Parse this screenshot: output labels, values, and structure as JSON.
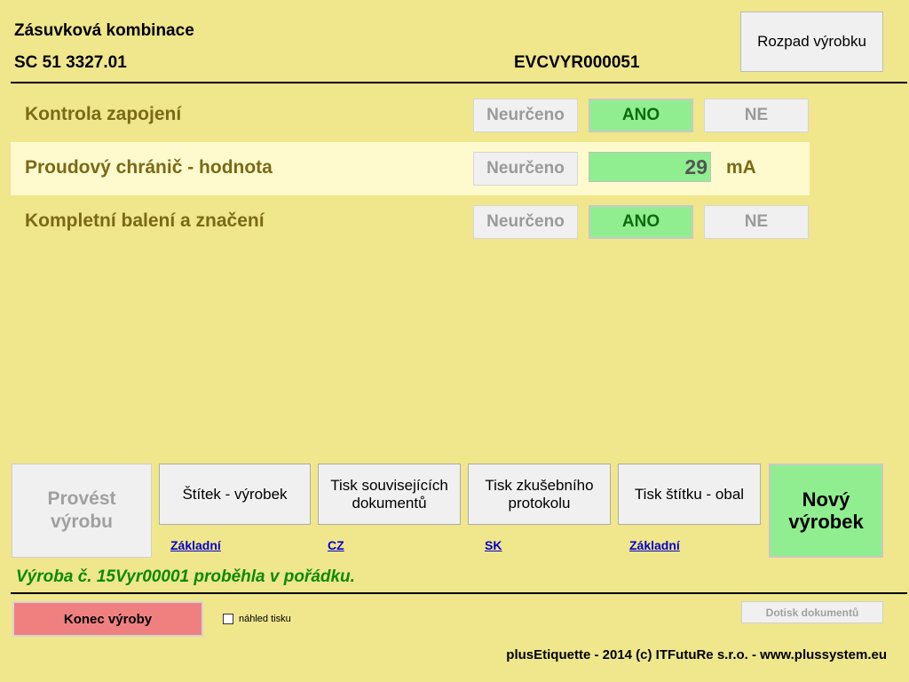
{
  "header": {
    "product_name": "Zásuvková kombinace",
    "product_code": "SC 51 3327.01",
    "record_id": "EVCVYR000051",
    "breakdown_button": "Rozpad výrobku"
  },
  "checks": [
    {
      "label": "Kontrola zapojení",
      "undetermined": "Neurčeno",
      "yes": "ANO",
      "no": "NE"
    },
    {
      "label": "Proudový chránič - hodnota",
      "undetermined": "Neurčeno",
      "value": "29",
      "unit": "mA"
    },
    {
      "label": "Kompletní balení a značení",
      "undetermined": "Neurčeno",
      "yes": "ANO",
      "no": "NE"
    }
  ],
  "toolbar": {
    "perform": "Provést výrobu",
    "label_product": "Štítek - výrobek",
    "label_product_link": "Základní",
    "print_docs": "Tisk souvisejících dokumentů",
    "print_docs_link": "CZ",
    "print_protocol": "Tisk zkušebního protokolu",
    "print_protocol_link": "SK",
    "print_package": "Tisk štítku - obal",
    "print_package_link": "Základní",
    "new_product": "Nový výrobek"
  },
  "status_message": "Výroba č. 15Vyr00001 proběhla v pořádku.",
  "footer": {
    "end_production": "Konec výroby",
    "print_preview": "náhled tisku",
    "reprint": "Dotisk dokumentů",
    "copyright": "plusEtiquette - 2014 (c) ITFutuRe s.r.o. - www.plussystem.eu"
  },
  "colors": {
    "background": "#f0e68c",
    "active_green": "#90ee90",
    "end_button": "#f08080",
    "status_green": "#0a8a0a",
    "label_olive": "#7a6a16"
  }
}
